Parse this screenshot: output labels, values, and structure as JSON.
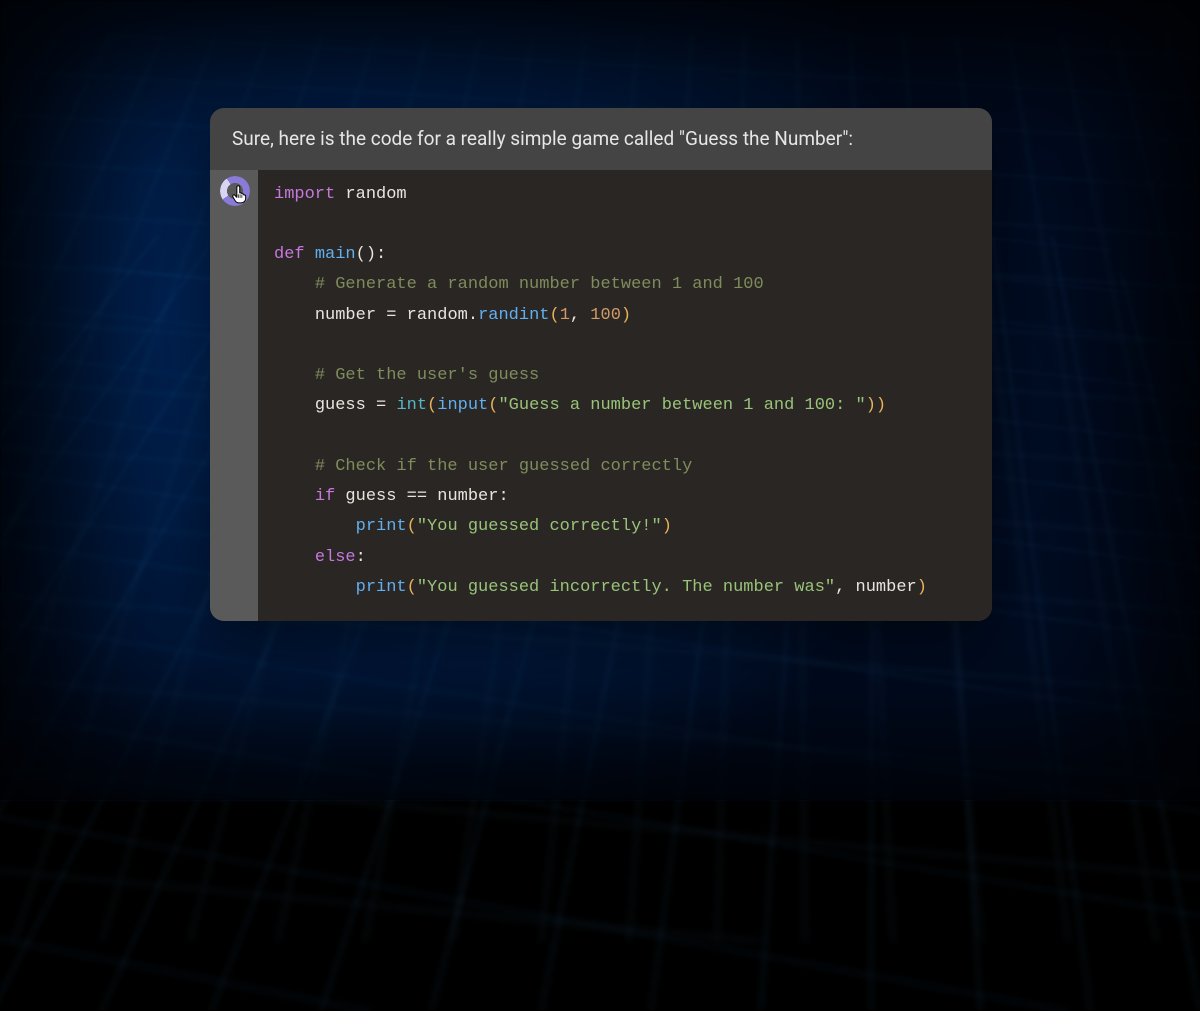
{
  "chat": {
    "intro_text": "Sure, here is the code for a really simple game called \"Guess the Number\":"
  },
  "code": {
    "tokens": {
      "import": "import",
      "random": "random",
      "def": "def",
      "main": "main",
      "c1": "# Generate a random number between 1 and 100",
      "number": "number",
      "eq": "=",
      "random2": "random",
      "randint": "randint",
      "one": "1",
      "hundred": "100",
      "c2": "# Get the user's guess",
      "guess": "guess",
      "int": "int",
      "input": "input",
      "s1": "\"Guess a number between 1 and 100: \"",
      "c3": "# Check if the user guessed correctly",
      "if": "if",
      "eqeq": "==",
      "print1": "print",
      "s2": "\"You guessed correctly!\"",
      "else": "else",
      "print2": "print",
      "s3": "\"You guessed incorrectly. The number was\""
    }
  },
  "icons": {
    "loader": "loading-spinner-icon",
    "cursor": "hand-pointer-cursor-icon"
  }
}
